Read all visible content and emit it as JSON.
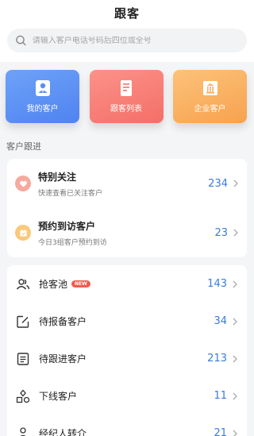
{
  "header": {
    "title": "跟客"
  },
  "search": {
    "placeholder": "请输入客户电话号码后四位或全号"
  },
  "quick_actions": [
    {
      "label": "我的客户",
      "icon": "person-icon",
      "color": "#5a8ff4"
    },
    {
      "label": "跟客列表",
      "icon": "document-list-icon",
      "color": "#f77f76"
    },
    {
      "label": "企业客户",
      "icon": "building-icon",
      "color": "#f8b062"
    }
  ],
  "section": {
    "label": "客户跟进"
  },
  "follow_items": [
    {
      "title": "特别关注",
      "subtitle": "快速查看已关注客户",
      "count": "234",
      "icon": "heart-icon"
    },
    {
      "title": "预约到访客户",
      "subtitle": "今日3组客户预约到访",
      "count": "23",
      "icon": "calendar-icon"
    }
  ],
  "list_items": [
    {
      "label": "抢客池",
      "badge": "NEW",
      "count": "143",
      "icon": "people-icon"
    },
    {
      "label": "待报备客户",
      "count": "34",
      "icon": "edit-icon"
    },
    {
      "label": "待跟进客户",
      "count": "213",
      "icon": "list-icon"
    },
    {
      "label": "下线客户",
      "count": "11",
      "icon": "hierarchy-icon"
    },
    {
      "label": "经纪人转介",
      "count": "21",
      "icon": "transfer-icon"
    }
  ],
  "colors": {
    "accent": "#3a7be0",
    "badge": "#f25b4d"
  }
}
